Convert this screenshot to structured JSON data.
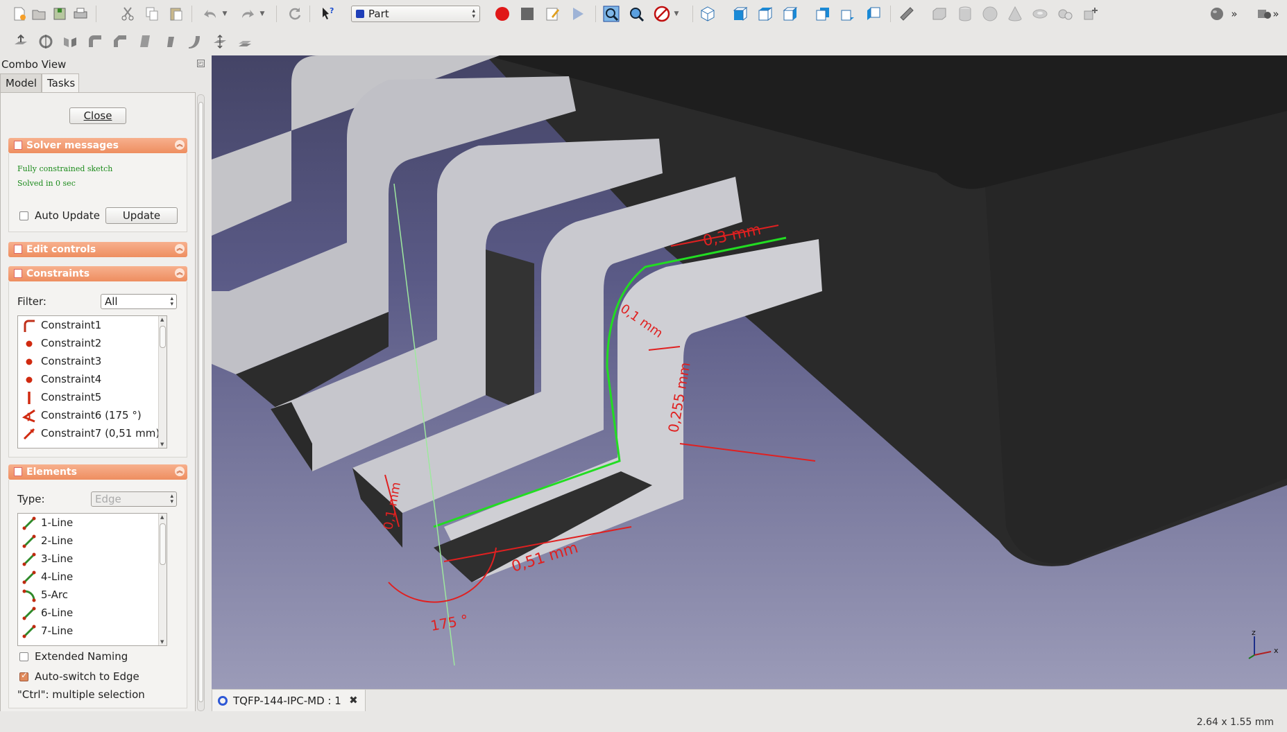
{
  "toolbar": {
    "workbench": "Part",
    "icons1": [
      "new-icon",
      "open-icon",
      "save-icon",
      "print-icon",
      "cut-icon",
      "copy-icon",
      "paste-icon",
      "undo-icon",
      "redo-icon",
      "refresh-icon",
      "whats-this-icon",
      "record-macro-icon",
      "stop-macro-icon",
      "edit-macro-icon",
      "run-macro-icon",
      "fit-all-icon",
      "fit-selection-icon",
      "draw-style-icon",
      "isometric-view-icon",
      "front-view-icon",
      "top-view-icon",
      "right-view-icon",
      "rear-view-icon",
      "bottom-view-icon",
      "left-view-icon",
      "measure-icon",
      "box-icon",
      "cylinder-icon",
      "sphere-icon",
      "cone-icon",
      "torus-icon",
      "tube-icon",
      "primitives-icon",
      "shape-builder-icon"
    ],
    "icons2": [
      "extrude-icon",
      "revolve-icon",
      "mirror-icon",
      "fillet-icon",
      "chamfer-icon",
      "ruled-surface-icon",
      "loft-icon",
      "sweep-icon",
      "section-icon",
      "offset-icon"
    ]
  },
  "combo": {
    "title": "Combo View",
    "tabs": [
      "Model",
      "Tasks"
    ],
    "close_label": "Close",
    "solver": {
      "title": "Solver messages",
      "line1": "Fully constrained sketch",
      "line2": "Solved in 0 sec",
      "auto_update_label": "Auto Update",
      "update_label": "Update"
    },
    "edit_controls": {
      "title": "Edit controls"
    },
    "constraints": {
      "title": "Constraints",
      "filter_label": "Filter:",
      "filter_value": "All",
      "items": [
        "Constraint1",
        "Constraint2",
        "Constraint3",
        "Constraint4",
        "Constraint5",
        "Constraint6 (175 °)",
        "Constraint7 (0,51 mm)"
      ]
    },
    "elements": {
      "title": "Elements",
      "type_label": "Type:",
      "type_value": "Edge",
      "items": [
        "1-Line",
        "2-Line",
        "3-Line",
        "4-Line",
        "5-Arc",
        "6-Line",
        "7-Line"
      ],
      "extended_naming_label": "Extended Naming",
      "auto_switch_label": "Auto-switch to Edge",
      "hint": "\"Ctrl\": multiple selection"
    }
  },
  "viewport": {
    "dimensions": [
      "0,3 mm",
      "0,1 mm",
      "0,255 mm",
      "0,51 mm",
      "175 °",
      "0,1 mm"
    ],
    "axis": {
      "x": "x",
      "z": "z"
    }
  },
  "document_tab": "TQFP-144-IPC-MD : 1",
  "status": {
    "dimensions": "2.64 x 1.55 mm"
  },
  "colors": {
    "accent_orange": "#ee8e60",
    "sketch_green": "#22dd22",
    "dimension_red": "#e02020",
    "solver_green": "#1a8a1a"
  }
}
